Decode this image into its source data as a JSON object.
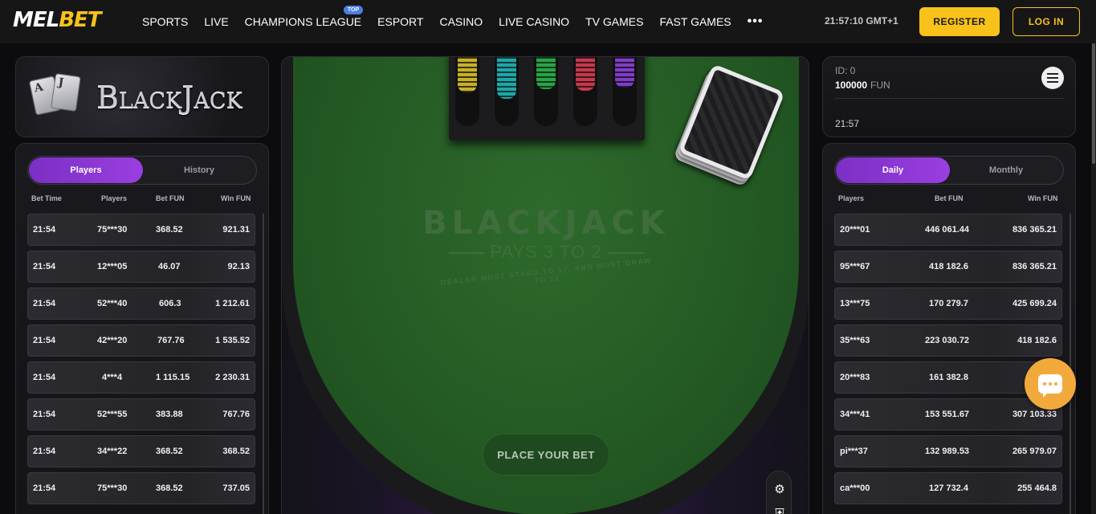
{
  "brand": {
    "logo_part1": "MEL",
    "logo_part2": "BET"
  },
  "nav": {
    "items": [
      "SPORTS",
      "LIVE",
      "CHAMPIONS LEAGUE",
      "ESPORT",
      "CASINO",
      "LIVE CASINO",
      "TV GAMES",
      "FAST GAMES"
    ],
    "badge": "TOP",
    "more": "•••"
  },
  "header": {
    "clock": "21:57:10 GMT+1",
    "register": "REGISTER",
    "login": "LOG IN"
  },
  "game_logo": {
    "title": "BlackJack",
    "card1": "A",
    "card2": "J"
  },
  "players_panel": {
    "tabs": [
      "Players",
      "History"
    ],
    "active_tab": "Players",
    "columns": [
      "Bet Time",
      "Players",
      "Bet  FUN",
      "Win  FUN"
    ],
    "rows": [
      [
        "21:54",
        "75***30",
        "368.52",
        "921.31"
      ],
      [
        "21:54",
        "12***05",
        "46.07",
        "92.13"
      ],
      [
        "21:54",
        "52***40",
        "606.3",
        "1 212.61"
      ],
      [
        "21:54",
        "42***20",
        "767.76",
        "1 535.52"
      ],
      [
        "21:54",
        "4***4",
        "1 115.15",
        "2 230.31"
      ],
      [
        "21:54",
        "52***55",
        "383.88",
        "767.76"
      ],
      [
        "21:54",
        "34***22",
        "368.52",
        "368.52"
      ],
      [
        "21:54",
        "75***30",
        "368.52",
        "737.05"
      ]
    ]
  },
  "account": {
    "id": "ID: 0",
    "balance": "100000",
    "currency": "FUN",
    "time": "21:57"
  },
  "leaders_panel": {
    "tabs": [
      "Daily",
      "Monthly"
    ],
    "active_tab": "Daily",
    "columns": [
      "Players",
      "Bet  FUN",
      "Win  FUN"
    ],
    "rows": [
      [
        "20***01",
        "446 061.44",
        "836 365.21"
      ],
      [
        "95***67",
        "418 182.6",
        "836 365.21"
      ],
      [
        "13***75",
        "170 279.7",
        "425 699.24"
      ],
      [
        "35***63",
        "223 030.72",
        "418 182.6"
      ],
      [
        "20***83",
        "161 382.8",
        "32"
      ],
      [
        "34***41",
        "153 551.67",
        "307 103.33"
      ],
      [
        "pi***37",
        "132 989.53",
        "265 979.07"
      ],
      [
        "ca***00",
        "127 732.4",
        "255 464.8"
      ]
    ]
  },
  "table": {
    "title": "BLACKJACK",
    "subtitle": "PAYS 3 TO 2",
    "rule": "DEALER MUST STAND TO 17, AND MUST DRAW TO 16",
    "place_bet": "PLACE YOUR BET",
    "chip_colors": [
      "#c7b12a",
      "#1fa7a8",
      "#2aa348",
      "#c23a4e",
      "#7d3fbf"
    ]
  },
  "colors": {
    "accent": "#f8c21b",
    "purple": "#8a36d3",
    "felt": "#245a24"
  }
}
